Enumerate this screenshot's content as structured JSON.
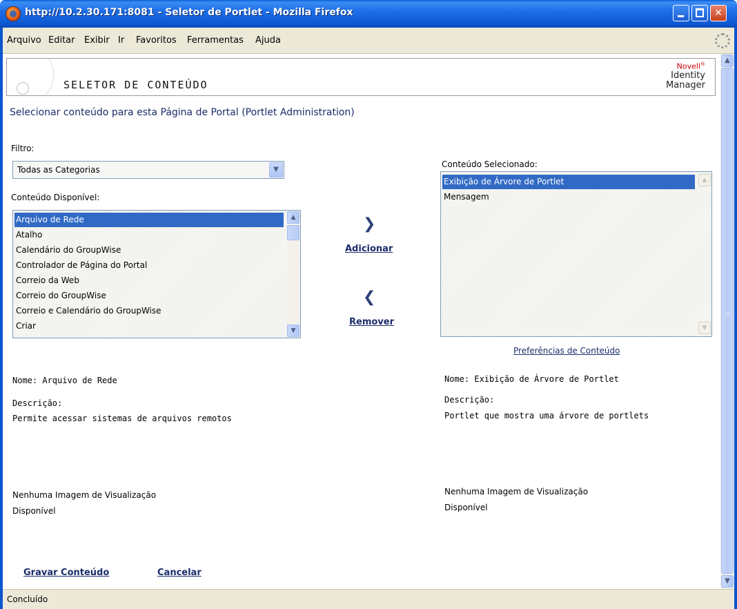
{
  "window": {
    "title": "http://10.2.30.171:8081 - Seletor de Portlet - Mozilla Firefox"
  },
  "menu": [
    "Arquivo",
    "Editar",
    "Exibir",
    "Ir",
    "Favoritos",
    "Ferramentas",
    "Ajuda"
  ],
  "header": {
    "title": "SELETOR DE CONTEÚDO",
    "brand": "Novell",
    "product_line1": "Identity",
    "product_line2": "Manager"
  },
  "page": {
    "heading": "Selecionar conteúdo para esta Página de Portal (Portlet Administration)"
  },
  "filter": {
    "label": "Filtro:",
    "selected": "Todas as Categorias"
  },
  "available": {
    "label": "Conteúdo Disponível:",
    "items": [
      "Arquivo de Rede",
      "Atalho",
      "Calendário do GroupWise",
      "Controlador de Página do Portal",
      "Correio da Web",
      "Correio do GroupWise",
      "Correio e Calendário do GroupWise",
      "Criar"
    ],
    "selected_index": 0,
    "name_label": "Nome:",
    "name_value": "Arquivo de Rede",
    "desc_label": "Descrição:",
    "desc_value": "Permite acessar sistemas de arquivos remotos",
    "preview_line1": "Nenhuma Imagem de Visualização",
    "preview_line2": "Disponível"
  },
  "actions": {
    "add": "Adicionar",
    "remove": "Remover",
    "save": "Gravar Conteúdo",
    "cancel": "Cancelar"
  },
  "selected": {
    "label": "Conteúdo Selecionado:",
    "items": [
      "Exibição de Árvore de Portlet",
      "Mensagem"
    ],
    "selected_index": 0,
    "preferences_link": "Preferências de Conteúdo",
    "name_label": "Nome:",
    "name_value": "Exibição de Árvore de Portlet",
    "desc_label": "Descrição:",
    "desc_value": "Portlet que mostra uma árvore de portlets",
    "preview_line1": "Nenhuma Imagem de Visualização",
    "preview_line2": "Disponível"
  },
  "status": {
    "text": "Concluído"
  },
  "colors": {
    "titlebar": "#0b57d0",
    "selection": "#316ac5",
    "link": "#1b2d6a"
  }
}
